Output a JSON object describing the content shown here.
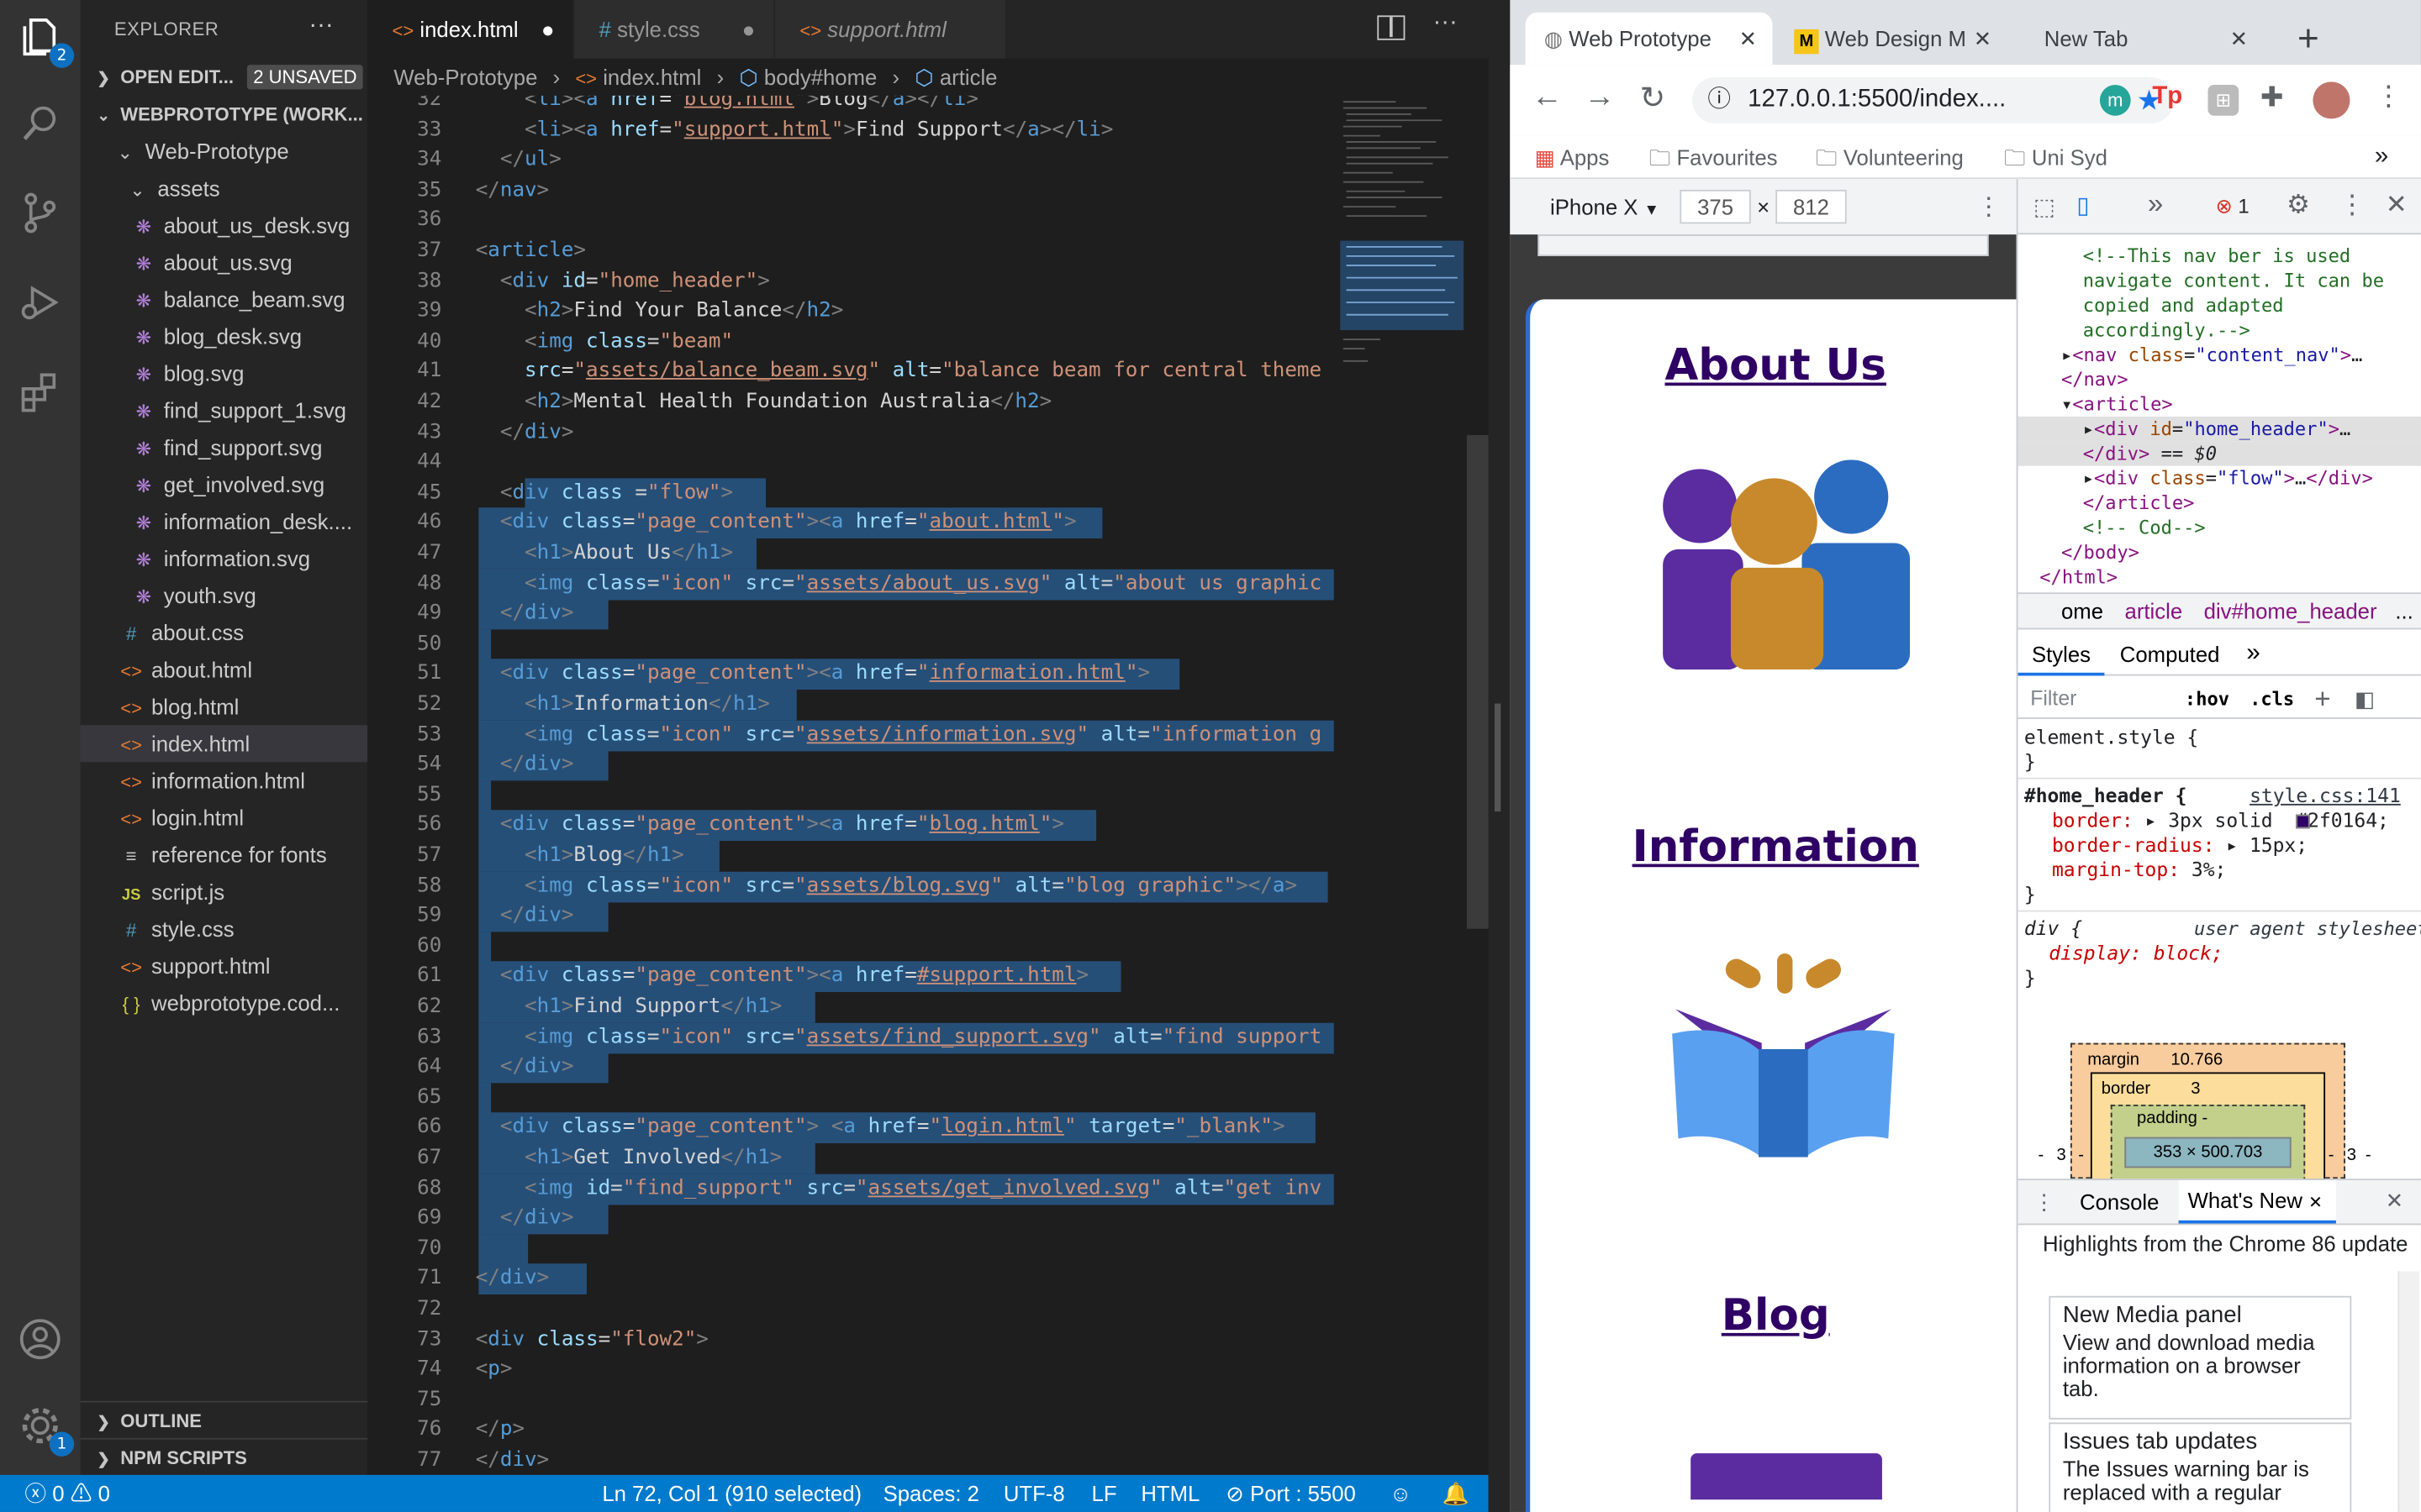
{
  "activity": {
    "explorer_badge": "2",
    "settings_badge": "1"
  },
  "sidebar": {
    "title": "EXPLORER",
    "more": "···",
    "open_editors": "OPEN EDIT...",
    "unsaved": "2 UNSAVED",
    "workspace": "WEBPROTOTYPE (WORK...",
    "items": [
      {
        "label": "Web-Prototype",
        "kind": "folder-open",
        "indent": 1
      },
      {
        "label": "assets",
        "kind": "folder-open",
        "indent": 2
      },
      {
        "label": "about_us_desk.svg",
        "kind": "svg",
        "indent": 3
      },
      {
        "label": "about_us.svg",
        "kind": "svg",
        "indent": 3
      },
      {
        "label": "balance_beam.svg",
        "kind": "svg",
        "indent": 3
      },
      {
        "label": "blog_desk.svg",
        "kind": "svg",
        "indent": 3
      },
      {
        "label": "blog.svg",
        "kind": "svg",
        "indent": 3
      },
      {
        "label": "find_support_1.svg",
        "kind": "svg",
        "indent": 3
      },
      {
        "label": "find_support.svg",
        "kind": "svg",
        "indent": 3
      },
      {
        "label": "get_involved.svg",
        "kind": "svg",
        "indent": 3
      },
      {
        "label": "information_desk....",
        "kind": "svg",
        "indent": 3
      },
      {
        "label": "information.svg",
        "kind": "svg",
        "indent": 3
      },
      {
        "label": "youth.svg",
        "kind": "svg",
        "indent": 3
      },
      {
        "label": "about.css",
        "kind": "css",
        "indent": 2
      },
      {
        "label": "about.html",
        "kind": "html",
        "indent": 2
      },
      {
        "label": "blog.html",
        "kind": "html",
        "indent": 2
      },
      {
        "label": "index.html",
        "kind": "html",
        "indent": 2,
        "selected": true
      },
      {
        "label": "information.html",
        "kind": "html",
        "indent": 2
      },
      {
        "label": "login.html",
        "kind": "html",
        "indent": 2
      },
      {
        "label": "reference for fonts",
        "kind": "text",
        "indent": 2
      },
      {
        "label": "script.js",
        "kind": "js",
        "indent": 2
      },
      {
        "label": "style.css",
        "kind": "css",
        "indent": 2
      },
      {
        "label": "support.html",
        "kind": "html",
        "indent": 2
      },
      {
        "label": "webprototype.cod...",
        "kind": "json",
        "indent": 2
      }
    ],
    "outline": "OUTLINE",
    "npm": "NPM SCRIPTS"
  },
  "tabs": [
    {
      "label": "index.html",
      "icon": "<>",
      "dirty": true,
      "active": true
    },
    {
      "label": "style.css",
      "icon": "#",
      "dirty": true,
      "active": false
    },
    {
      "label": "support.html",
      "icon": "<>",
      "dirty": false,
      "active": false,
      "italic": true
    }
  ],
  "breadcrumb": [
    "Web-Prototype",
    "index.html",
    "body#home",
    "article"
  ],
  "code": {
    "lines": [
      {
        "n": "32",
        "html": "<span class=\"g\">    &lt;</span><span class=\"t\">li</span><span class=\"g\">&gt;&lt;</span><span class=\"t\">a</span> <span class=\"a\">href</span>=<span class=\"s\">\"<span class=\"u\">blog.html</span>\"</span><span class=\"g\">&gt;</span>Blog<span class=\"g\">&lt;/</span><span class=\"t\">a</span><span class=\"g\">&gt;&lt;/</span><span class=\"t\">li</span><span class=\"g\">&gt;</span>"
      },
      {
        "n": "33",
        "html": "<span class=\"g\">    &lt;</span><span class=\"t\">li</span><span class=\"g\">&gt;&lt;</span><span class=\"t\">a</span> <span class=\"a\">href</span>=<span class=\"s\">\"<span class=\"u\">support.html</span>\"</span><span class=\"g\">&gt;</span>Find Support<span class=\"g\">&lt;/</span><span class=\"t\">a</span><span class=\"g\">&gt;&lt;/</span><span class=\"t\">li</span><span class=\"g\">&gt;</span>"
      },
      {
        "n": "34",
        "html": "<span class=\"g\">  &lt;/</span><span class=\"t\">ul</span><span class=\"g\">&gt;</span>"
      },
      {
        "n": "35",
        "html": "<span class=\"g\">&lt;/</span><span class=\"t\">nav</span><span class=\"g\">&gt;</span>"
      },
      {
        "n": "36",
        "html": ""
      },
      {
        "n": "37",
        "html": "<span class=\"g\">&lt;</span><span class=\"t\">article</span><span class=\"g\">&gt;</span>"
      },
      {
        "n": "38",
        "html": "<span class=\"g\">  &lt;</span><span class=\"t\">div</span> <span class=\"a\">id</span>=<span class=\"s\">\"home_header\"</span><span class=\"g\">&gt;</span>"
      },
      {
        "n": "39",
        "html": "<span class=\"g\">    &lt;</span><span class=\"t\">h2</span><span class=\"g\">&gt;</span>Find Your Balance<span class=\"g\">&lt;/</span><span class=\"t\">h2</span><span class=\"g\">&gt;</span>"
      },
      {
        "n": "40",
        "html": "<span class=\"g\">    &lt;</span><span class=\"t\">img</span> <span class=\"a\">class</span>=<span class=\"s\">\"beam\"</span>"
      },
      {
        "n": "41",
        "html": "    <span class=\"a\">src</span>=<span class=\"s\">\"<span class=\"u\">assets/balance_beam.svg</span>\"</span> <span class=\"a\">alt</span>=<span class=\"s\">\"balance beam for central theme</span>"
      },
      {
        "n": "42",
        "html": "<span class=\"g\">    &lt;</span><span class=\"t\">h2</span><span class=\"g\">&gt;</span>Mental Health Foundation Australia<span class=\"g\">&lt;/</span><span class=\"t\">h2</span><span class=\"g\">&gt;</span>"
      },
      {
        "n": "43",
        "html": "<span class=\"g\">  &lt;/</span><span class=\"t\">div</span><span class=\"g\">&gt;</span>"
      },
      {
        "n": "44",
        "html": ""
      },
      {
        "n": "45",
        "html": "<span class=\"g\">  &lt;</span><span class=\"t\">div</span> <span class=\"a\">class</span> =<span class=\"s\">\"flow\"</span><span class=\"g\">&gt;</span>"
      },
      {
        "n": "46",
        "html": "<span class=\"g\">  &lt;</span><span class=\"t\">div</span> <span class=\"a\">class</span>=<span class=\"s\">\"page_content\"</span><span class=\"g\">&gt;&lt;</span><span class=\"t\">a</span> <span class=\"a\">href</span>=<span class=\"s\">\"<span class=\"u\">about.html</span>\"</span><span class=\"g\">&gt;</span>"
      },
      {
        "n": "47",
        "html": "<span class=\"g\">    &lt;</span><span class=\"t\">h1</span><span class=\"g\">&gt;</span>About Us<span class=\"g\">&lt;/</span><span class=\"t\">h1</span><span class=\"g\">&gt;</span>"
      },
      {
        "n": "48",
        "html": "<span class=\"g\">    &lt;</span><span class=\"t\">img</span> <span class=\"a\">class</span>=<span class=\"s\">\"icon\"</span> <span class=\"a\">src</span>=<span class=\"s\">\"<span class=\"u\">assets/about_us.svg</span>\"</span> <span class=\"a\">alt</span>=<span class=\"s\">\"about us graphic</span>"
      },
      {
        "n": "49",
        "html": "<span class=\"g\">  &lt;/</span><span class=\"t\">div</span><span class=\"g\">&gt;</span>"
      },
      {
        "n": "50",
        "html": ""
      },
      {
        "n": "51",
        "html": "<span class=\"g\">  &lt;</span><span class=\"t\">div</span> <span class=\"a\">class</span>=<span class=\"s\">\"page_content\"</span><span class=\"g\">&gt;&lt;</span><span class=\"t\">a</span> <span class=\"a\">href</span>=<span class=\"s\">\"<span class=\"u\">information.html</span>\"</span><span class=\"g\">&gt;</span>"
      },
      {
        "n": "52",
        "html": "<span class=\"g\">    &lt;</span><span class=\"t\">h1</span><span class=\"g\">&gt;</span>Information<span class=\"g\">&lt;/</span><span class=\"t\">h1</span><span class=\"g\">&gt;</span>"
      },
      {
        "n": "53",
        "html": "<span class=\"g\">    &lt;</span><span class=\"t\">img</span> <span class=\"a\">class</span>=<span class=\"s\">\"icon\"</span> <span class=\"a\">src</span>=<span class=\"s\">\"<span class=\"u\">assets/information.svg</span>\"</span> <span class=\"a\">alt</span>=<span class=\"s\">\"information g</span>"
      },
      {
        "n": "54",
        "html": "<span class=\"g\">  &lt;/</span><span class=\"t\">div</span><span class=\"g\">&gt;</span>"
      },
      {
        "n": "55",
        "html": ""
      },
      {
        "n": "56",
        "html": "<span class=\"g\">  &lt;</span><span class=\"t\">div</span> <span class=\"a\">class</span>=<span class=\"s\">\"page_content\"</span><span class=\"g\">&gt;&lt;</span><span class=\"t\">a</span> <span class=\"a\">href</span>=<span class=\"s\">\"<span class=\"u\">blog.html</span>\"</span><span class=\"g\">&gt;</span>"
      },
      {
        "n": "57",
        "html": "<span class=\"g\">    &lt;</span><span class=\"t\">h1</span><span class=\"g\">&gt;</span>Blog<span class=\"g\">&lt;/</span><span class=\"t\">h1</span><span class=\"g\">&gt;</span>"
      },
      {
        "n": "58",
        "html": "<span class=\"g\">    &lt;</span><span class=\"t\">img</span> <span class=\"a\">class</span>=<span class=\"s\">\"icon\"</span> <span class=\"a\">src</span>=<span class=\"s\">\"<span class=\"u\">assets/blog.svg</span>\"</span> <span class=\"a\">alt</span>=<span class=\"s\">\"blog graphic\"</span><span class=\"g\">&gt;&lt;/</span><span class=\"t\">a</span><span class=\"g\">&gt;</span>"
      },
      {
        "n": "59",
        "html": "<span class=\"g\">  &lt;/</span><span class=\"t\">div</span><span class=\"g\">&gt;</span>"
      },
      {
        "n": "60",
        "html": ""
      },
      {
        "n": "61",
        "html": "<span class=\"g\">  &lt;</span><span class=\"t\">div</span> <span class=\"a\">class</span>=<span class=\"s\">\"page_content\"</span><span class=\"g\">&gt;&lt;</span><span class=\"t\">a</span> <span class=\"a\">href</span>=<span class=\"s\"><span class=\"u\">#support.html</span></span><span class=\"g\">&gt;</span>"
      },
      {
        "n": "62",
        "html": "<span class=\"g\">    &lt;</span><span class=\"t\">h1</span><span class=\"g\">&gt;</span>Find Support<span class=\"g\">&lt;/</span><span class=\"t\">h1</span><span class=\"g\">&gt;</span>"
      },
      {
        "n": "63",
        "html": "<span class=\"g\">    &lt;</span><span class=\"t\">img</span> <span class=\"a\">class</span>=<span class=\"s\">\"icon\"</span> <span class=\"a\">src</span>=<span class=\"s\">\"<span class=\"u\">assets/find_support.svg</span>\"</span> <span class=\"a\">alt</span>=<span class=\"s\">\"find support</span>"
      },
      {
        "n": "64",
        "html": "<span class=\"g\">  &lt;/</span><span class=\"t\">div</span><span class=\"g\">&gt;</span>"
      },
      {
        "n": "65",
        "html": ""
      },
      {
        "n": "66",
        "html": "<span class=\"g\">  &lt;</span><span class=\"t\">div</span> <span class=\"a\">class</span>=<span class=\"s\">\"page_content\"</span><span class=\"g\">&gt;</span> <span class=\"g\">&lt;</span><span class=\"t\">a</span> <span class=\"a\">href</span>=<span class=\"s\">\"<span class=\"u\">login.html</span>\"</span> <span class=\"a\">target</span>=<span class=\"s\">\"_blank\"</span><span class=\"g\">&gt;</span>"
      },
      {
        "n": "67",
        "html": "<span class=\"g\">    &lt;</span><span class=\"t\">h1</span><span class=\"g\">&gt;</span>Get Involved<span class=\"g\">&lt;/</span><span class=\"t\">h1</span><span class=\"g\">&gt;</span>"
      },
      {
        "n": "68",
        "html": "<span class=\"g\">    &lt;</span><span class=\"t\">img</span> <span class=\"a\">id</span>=<span class=\"s\">\"find_support\"</span> <span class=\"a\">src</span>=<span class=\"s\">\"<span class=\"u\">assets/get_involved.svg</span>\"</span> <span class=\"a\">alt</span>=<span class=\"s\">\"get inv</span>"
      },
      {
        "n": "69",
        "html": "<span class=\"g\">  &lt;/</span><span class=\"t\">div</span><span class=\"g\">&gt;</span>"
      },
      {
        "n": "70",
        "html": ""
      },
      {
        "n": "71",
        "html": "<span class=\"g\">&lt;/</span><span class=\"t\">div</span><span class=\"g\">&gt;</span>"
      },
      {
        "n": "72",
        "html": ""
      },
      {
        "n": "73",
        "html": "<span class=\"g\">&lt;</span><span class=\"t\">div</span> <span class=\"a\">class</span>=<span class=\"s\">\"flow2\"</span><span class=\"g\">&gt;</span>"
      },
      {
        "n": "74",
        "html": "<span class=\"g\">&lt;</span><span class=\"t\">p</span><span class=\"g\">&gt;</span>"
      },
      {
        "n": "75",
        "html": ""
      },
      {
        "n": "76",
        "html": "<span class=\"g\">&lt;/</span><span class=\"t\">p</span><span class=\"g\">&gt;</span>"
      },
      {
        "n": "77",
        "html": "<span class=\"g\">&lt;/</span><span class=\"t\">div</span><span class=\"g\">&gt;</span>"
      }
    ]
  },
  "status": {
    "errors": "0",
    "warnings": "0",
    "position": "Ln 72, Col 1 (910 selected)",
    "spaces": "Spaces: 2",
    "encoding": "UTF-8",
    "eol": "LF",
    "language": "HTML",
    "port": "Port : 5500"
  },
  "browser": {
    "tabs": [
      "Web Prototype",
      "Web Design M",
      "New Tab"
    ],
    "url": "127.0.0.1:5500/index....",
    "bookmarks": [
      "Apps",
      "Favourites",
      "Volunteering",
      "Uni Syd"
    ],
    "device": "iPhone X",
    "width": "375",
    "height": "812",
    "times": "×",
    "errors": "1",
    "page": {
      "h_about": "About Us",
      "h_info": "Information",
      "h_blog": "Blog"
    }
  },
  "devtools": {
    "dom": [
      {
        "html": "<span class=\"dcom\">&lt;!--This nav ber is used</span>",
        "indent": 3
      },
      {
        "html": "<span class=\"dcom\">navigate content. It can be</span>",
        "indent": 3
      },
      {
        "html": "<span class=\"dcom\">copied and adapted</span>",
        "indent": 3
      },
      {
        "html": "<span class=\"dcom\">accordingly.--&gt;</span>",
        "indent": 3
      },
      {
        "html": "▸<span class=\"dtag\">&lt;nav</span> <span class=\"dattr\">class</span>=<span class=\"dval\">\"content_nav\"</span><span class=\"dtag\">&gt;</span>…",
        "indent": 2
      },
      {
        "html": "<span class=\"dtag\">&lt;/nav&gt;</span>",
        "indent": 2
      },
      {
        "html": "▾<span class=\"dtag\">&lt;article&gt;</span>",
        "indent": 2
      },
      {
        "html": "▸<span class=\"dtag\">&lt;div</span> <span class=\"dattr\">id</span>=<span class=\"dval\">\"home_header\"</span><span class=\"dtag\">&gt;</span>…",
        "indent": 3,
        "sel": true
      },
      {
        "html": "<span class=\"dtag\">&lt;/div&gt;</span> == <i>$0</i>",
        "indent": 3,
        "sel": true
      },
      {
        "html": "▸<span class=\"dtag\">&lt;div</span> <span class=\"dattr\">class</span>=<span class=\"dval\">\"flow\"</span><span class=\"dtag\">&gt;</span>…<span class=\"dtag\">&lt;/div&gt;</span>",
        "indent": 3
      },
      {
        "html": "<span class=\"dtag\">&lt;/article&gt;</span>",
        "indent": 3
      },
      {
        "html": "<span class=\"dcom\">&lt;!-- Cod--&gt;</span>",
        "indent": 3
      },
      {
        "html": "<span class=\"dtag\">&lt;/body&gt;</span>",
        "indent": 2
      },
      {
        "html": "<span class=\"dtag\">&lt;/html&gt;</span>",
        "indent": 1
      }
    ],
    "crumbs": [
      "ome",
      "article",
      "div#home_header",
      "..."
    ],
    "tabs": [
      "Styles",
      "Computed"
    ],
    "filter": "Filter",
    "hov": ":hov",
    "cls": ".cls",
    "element_style": "element.style {",
    "rule_selector": "#home_header {",
    "rule_source": "style.css:141",
    "props": [
      "border: ▸ 3px solid  #2f0164;",
      "border-radius: ▸ 15px;",
      "margin-top: 3%;"
    ],
    "div_rule": "div {",
    "ua": "user agent stylesheet",
    "display": "display: block;",
    "box": {
      "margin": "margin",
      "margin_val": "10.766",
      "border": "border",
      "border_val": "3",
      "padding": "padding -",
      "content": "353 × 500.703",
      "side": "3",
      "dash": "-"
    },
    "drawer_tabs": [
      "Console",
      "What's New"
    ],
    "highlights": "Highlights from the Chrome 86 update",
    "cards": [
      {
        "title": "New Media panel",
        "body": "View and download media information on a browser tab."
      },
      {
        "title": "Issues tab updates",
        "body": "The Issues warning bar is replaced with a regular"
      }
    ]
  },
  "colors": {
    "accent": "#007acc",
    "brand": "#2f0164",
    "selection": "#264f78"
  }
}
